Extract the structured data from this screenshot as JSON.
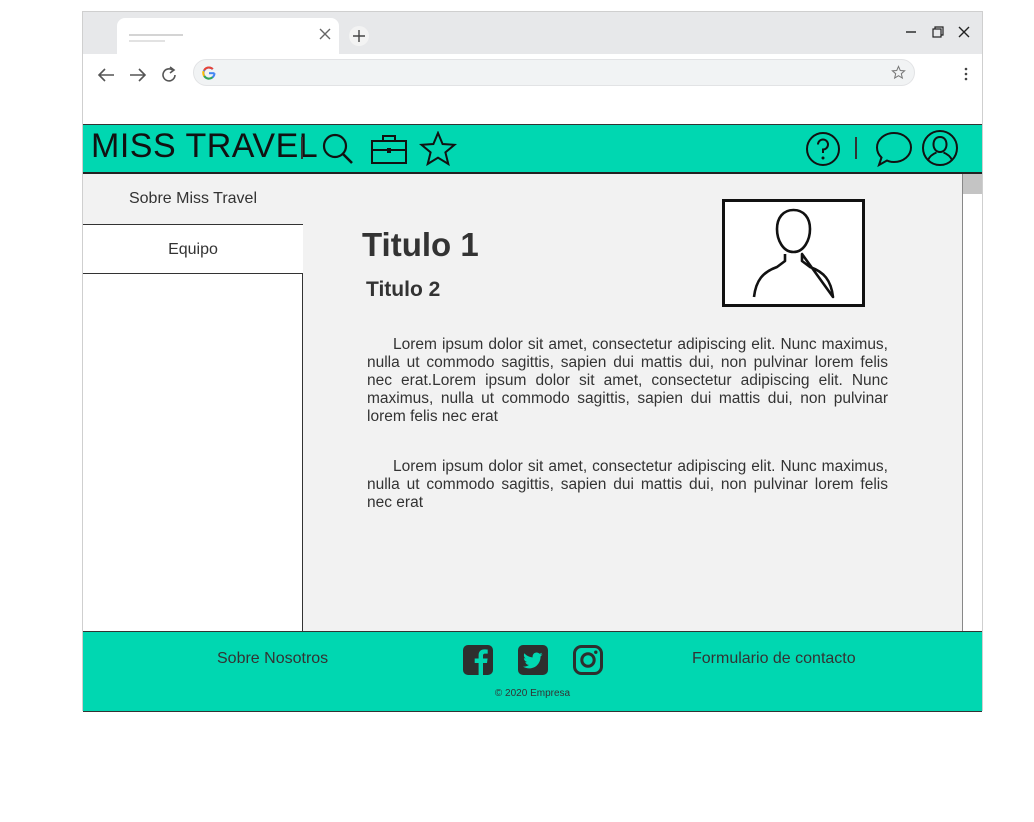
{
  "browser": {
    "tab_close": "close-icon",
    "new_tab": "plus-icon"
  },
  "site": {
    "brand": "MISS TRAVEL",
    "header_icons_left": [
      "search-icon",
      "briefcase-icon",
      "star-icon"
    ],
    "header_icons_right": [
      "help-icon",
      "chat-icon",
      "user-icon"
    ],
    "sidebar": {
      "items": [
        {
          "label": "Sobre Miss Travel"
        },
        {
          "label": "Equipo"
        }
      ]
    },
    "main": {
      "title1": "Titulo 1",
      "title2": "Titulo 2",
      "paragraph1": "Lorem ipsum dolor sit amet, consectetur adipiscing elit. Nunc maximus, nulla ut commodo sagittis, sapien dui mattis dui, non pulvinar lorem felis nec erat.Lorem ipsum dolor sit amet, consectetur adipiscing elit. Nunc maximus, nulla ut commodo sagittis, sapien dui mattis dui, non pulvinar lorem felis nec erat",
      "paragraph2": "Lorem ipsum dolor sit amet, consectetur adipiscing elit. Nunc maximus, nulla ut commodo sagittis, sapien dui mattis dui, non pulvinar lorem felis nec erat"
    },
    "footer": {
      "about": "Sobre Nosotros",
      "contact": "Formulario de contacto",
      "social": [
        "facebook-icon",
        "twitter-icon",
        "instagram-icon"
      ],
      "copyright": "© 2020 Empresa"
    },
    "colors": {
      "accent": "#00d7b1",
      "content_bg": "#f2f2f2"
    }
  }
}
